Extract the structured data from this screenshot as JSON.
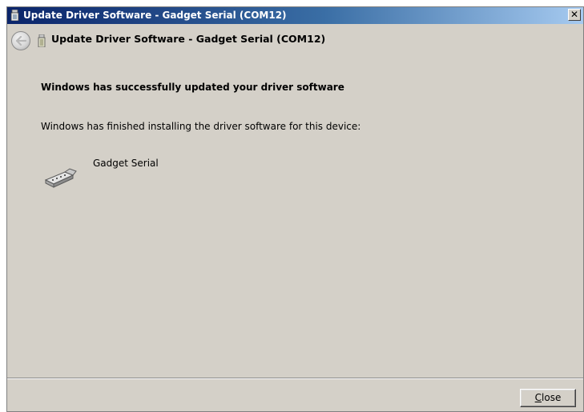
{
  "window": {
    "title": "Update Driver Software - Gadget Serial (COM12)",
    "close_glyph": "✕"
  },
  "wizard_header": {
    "title": "Update Driver Software - Gadget Serial (COM12)",
    "back_icon": "back-arrow-icon",
    "device_icon": "usb-device-icon"
  },
  "content": {
    "heading": "Windows has successfully updated your driver software",
    "description": "Windows has finished installing the driver software for this device:",
    "device": {
      "name": "Gadget Serial",
      "icon": "serial-port-icon"
    }
  },
  "footer": {
    "close_label": "Close",
    "close_mnemonic": "C",
    "close_rest": "lose"
  },
  "colors": {
    "title_start": "#0a246a",
    "title_end": "#a6caf0",
    "dialog_bg": "#d4d0c8"
  }
}
